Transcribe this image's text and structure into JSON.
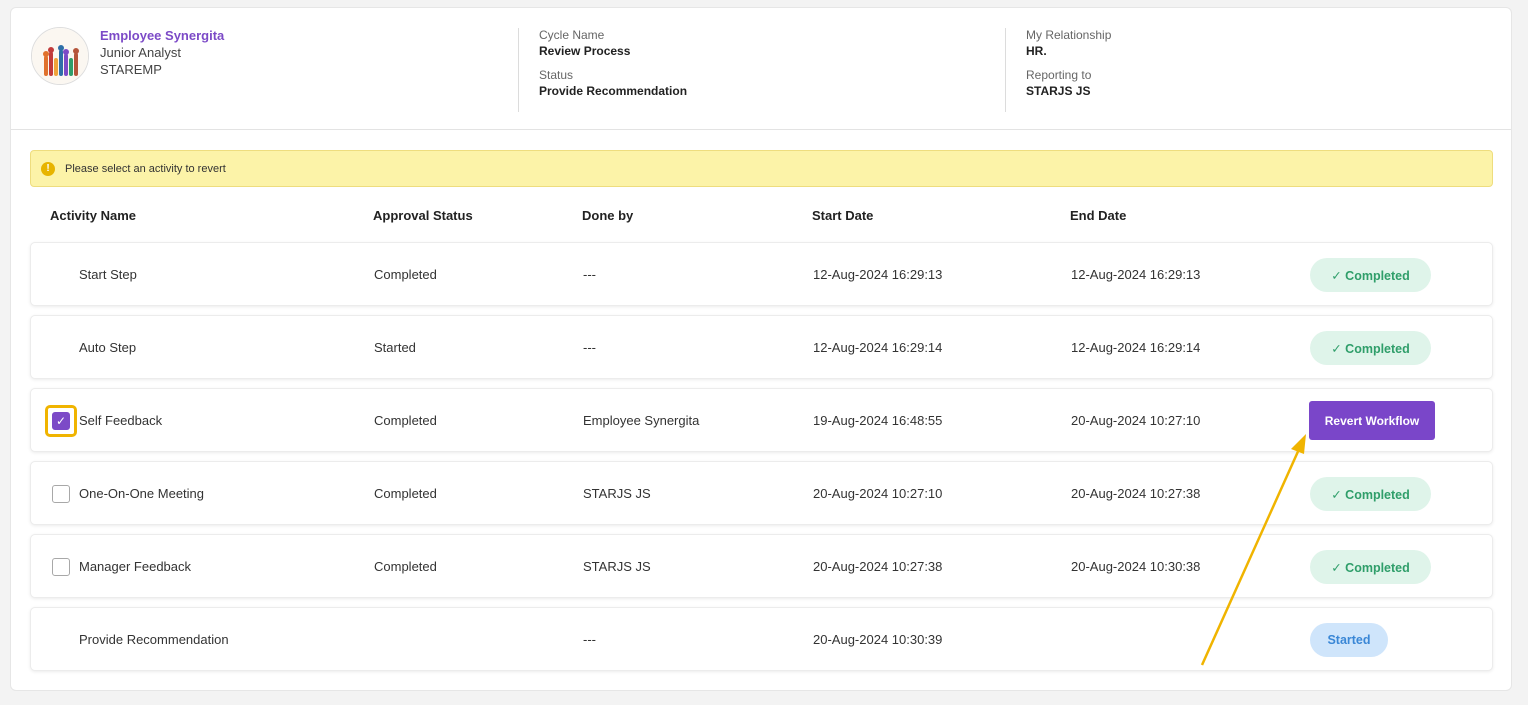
{
  "employee": {
    "name": "Employee Synergita",
    "designation": "Junior Analyst",
    "code": "STAREMP"
  },
  "cycle": {
    "cycle_name_label": "Cycle Name",
    "cycle_name": "Review Process",
    "status_label": "Status",
    "status": "Provide Recommendation"
  },
  "relationship": {
    "label": "My Relationship",
    "value": "HR.",
    "reporting_label": "Reporting to",
    "reporting_value": "STARJS JS"
  },
  "alert": {
    "icon": "info-icon",
    "text": "Please select an activity to revert"
  },
  "table": {
    "headers": {
      "activity": "Activity Name",
      "approval": "Approval Status",
      "done_by": "Done by",
      "start": "Start Date",
      "end": "End Date"
    },
    "rows": [
      {
        "name": "Start Step",
        "approval": "Completed",
        "done_by": "---",
        "start": "12-Aug-2024 16:29:13",
        "end": "12-Aug-2024 16:29:13",
        "status": "✓ Completed"
      },
      {
        "name": "Auto Step",
        "approval": "Started",
        "done_by": "---",
        "start": "12-Aug-2024 16:29:14",
        "end": "12-Aug-2024 16:29:14",
        "status": "✓ Completed"
      },
      {
        "name": "Self Feedback",
        "approval": "Completed",
        "done_by": "Employee Synergita",
        "start": "19-Aug-2024 16:48:55",
        "end": "20-Aug-2024 10:27:10",
        "action": "Revert Workflow",
        "checked": true
      },
      {
        "name": "One-On-One Meeting",
        "approval": "Completed",
        "done_by": "STARJS JS",
        "start": "20-Aug-2024 10:27:10",
        "end": "20-Aug-2024 10:27:38",
        "status": "✓ Completed",
        "checked": false
      },
      {
        "name": "Manager Feedback",
        "approval": "Completed",
        "done_by": "STARJS JS",
        "start": "20-Aug-2024 10:27:38",
        "end": "20-Aug-2024 10:30:38",
        "status": "✓ Completed",
        "checked": false
      },
      {
        "name": "Provide Recommendation",
        "approval": "",
        "done_by": "---",
        "start": "20-Aug-2024 10:30:39",
        "end": "",
        "status": "Started"
      }
    ]
  },
  "colors": {
    "accent": "#7c4ac7",
    "completed_bg": "#dff4ea",
    "completed_fg": "#2f9e6a",
    "started_bg": "#cfe5fb",
    "started_fg": "#3a87d6",
    "alert_bg": "#fcf3a8",
    "annotation": "#f0b400"
  }
}
